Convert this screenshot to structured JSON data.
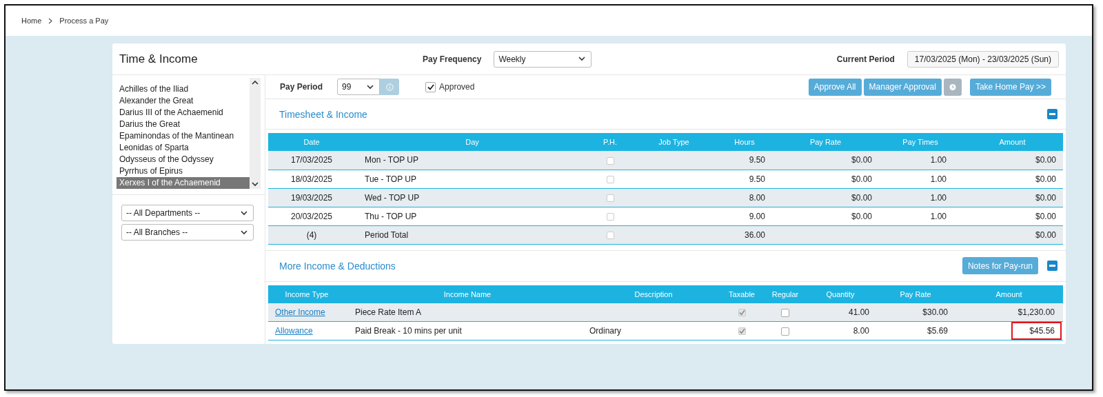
{
  "breadcrumb": [
    {
      "label": "Home"
    },
    {
      "label": "Process a Pay"
    }
  ],
  "title": "Time & Income",
  "pay_frequency": {
    "label": "Pay Frequency",
    "value": "Weekly"
  },
  "current_period": {
    "label": "Current Period",
    "value": "17/03/2025 (Mon) - 23/03/2025 (Sun)"
  },
  "employees": [
    {
      "name": "Achilles of the Iliad",
      "selected": false
    },
    {
      "name": "Alexander the Great",
      "selected": false
    },
    {
      "name": "Darius III of the Achaemenid",
      "selected": false
    },
    {
      "name": "Darius the Great",
      "selected": false
    },
    {
      "name": "Epaminondas of the Mantinean",
      "selected": false
    },
    {
      "name": "Leonidas of Sparta",
      "selected": false
    },
    {
      "name": "Odysseus of the Odyssey",
      "selected": false
    },
    {
      "name": "Pyrrhus of Epirus",
      "selected": false
    },
    {
      "name": "Xerxes I of the Achaemenid",
      "selected": true
    }
  ],
  "filters": [
    {
      "value": "-- All Departments --"
    },
    {
      "value": "-- All Branches --"
    }
  ],
  "pay_period": {
    "label": "Pay Period",
    "value": "99"
  },
  "approved": {
    "label": "Approved",
    "checked": true
  },
  "actions": [
    {
      "kind": "text",
      "label": "Approve All"
    },
    {
      "kind": "text",
      "label": "Manager Approval"
    },
    {
      "kind": "clock"
    },
    {
      "kind": "text",
      "label": "Take Home Pay >>"
    }
  ],
  "timesheet": {
    "title": "Timesheet & Income",
    "expanded": true,
    "columns": [
      "Date",
      "Day",
      "P.H.",
      "Job Type",
      "Hours",
      "Pay Rate",
      "Pay Times",
      "Amount"
    ],
    "rows": [
      {
        "kind": "day",
        "date": "17/03/2025",
        "day": "Mon - TOP UP",
        "ph": false,
        "hours": "9.50",
        "pay_rate": "$0.00",
        "pay_times": "1.00",
        "amount": "$0.00"
      },
      {
        "kind": "day",
        "date": "18/03/2025",
        "day": "Tue - TOP UP",
        "ph": false,
        "hours": "9.50",
        "pay_rate": "$0.00",
        "pay_times": "1.00",
        "amount": "$0.00"
      },
      {
        "kind": "day",
        "date": "19/03/2025",
        "day": "Wed - TOP UP",
        "ph": false,
        "hours": "8.00",
        "pay_rate": "$0.00",
        "pay_times": "1.00",
        "amount": "$0.00"
      },
      {
        "kind": "day",
        "date": "20/03/2025",
        "day": "Thu - TOP UP",
        "ph": false,
        "hours": "9.00",
        "pay_rate": "$0.00",
        "pay_times": "1.00",
        "amount": "$0.00"
      },
      {
        "kind": "total",
        "date": "(4)",
        "day": "Period Total",
        "ph": false,
        "hours": "36.00",
        "amount": "$0.00"
      }
    ]
  },
  "income": {
    "title": "More Income & Deductions",
    "notes_button": "Notes for Pay-run",
    "expanded": true,
    "columns": [
      "Income Type",
      "Income Name",
      "Description",
      "Taxable",
      "Regular",
      "Quantity",
      "Pay Rate",
      "Amount"
    ],
    "rows": [
      {
        "type": "Other Income",
        "name": "Piece Rate Item A",
        "taxable": true,
        "regular": false,
        "quantity": "41.00",
        "pay_rate": "$30.00",
        "amount": "$1,230.00",
        "highlighted": false
      },
      {
        "type": "Allowance",
        "name": "Paid Break - 10 mins per unit",
        "description": "Ordinary",
        "taxable": true,
        "regular": false,
        "quantity": "8.00",
        "pay_rate": "$5.69",
        "amount": "$45.56",
        "highlighted": true
      }
    ]
  }
}
